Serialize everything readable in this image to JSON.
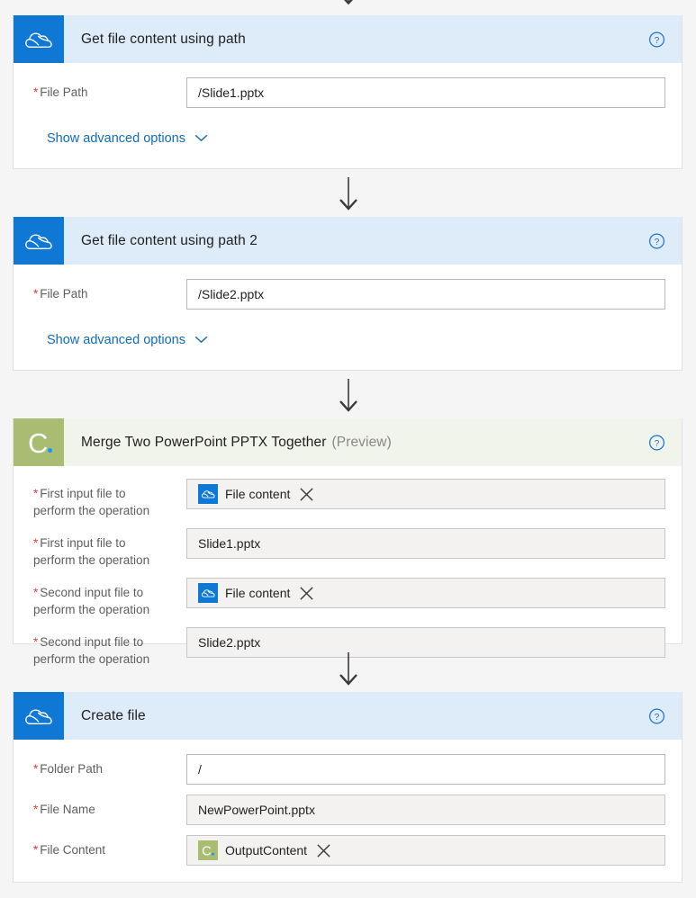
{
  "colors": {
    "page_background": "#f5f5f5",
    "onedrive_blue": "#0f78d4",
    "onedrive_header": "#deecf9",
    "cloudmersive_green": "#a8bc72",
    "cloudmersive_header": "#f1f4ea",
    "link_blue": "#0f6cbd",
    "required_red": "#e03e3e",
    "label_gray": "#605e5c",
    "preview_gray": "#8a8886"
  },
  "cards": [
    {
      "id": "get-file-content-using-path",
      "title": "Get file content using path",
      "preview": "",
      "connector_icon": "chevron-down-arrow-icon",
      "brand_icon": "onedrive-cloud-icon",
      "help_icon": "help-circle-icon",
      "fields": [
        {
          "label": "File Path",
          "required": true,
          "type": "text",
          "value": "/Slide1.pptx",
          "placeholder": "",
          "style": "white"
        }
      ],
      "advanced_link": {
        "label": "Show advanced options",
        "icon": "chevron-down-icon"
      }
    },
    {
      "id": "get-file-content-using-path-2",
      "title": "Get file content using path 2",
      "preview": "",
      "connector_icon": "chevron-down-arrow-icon",
      "brand_icon": "onedrive-cloud-icon",
      "help_icon": "help-circle-icon",
      "fields": [
        {
          "label": "File Path",
          "required": true,
          "type": "text",
          "value": "/Slide2.pptx",
          "placeholder": "",
          "style": "white"
        }
      ],
      "advanced_link": {
        "label": "Show advanced options",
        "icon": "chevron-down-icon"
      }
    },
    {
      "id": "merge-two-powerpoint-pptx-together",
      "title": "Merge Two PowerPoint PPTX Together",
      "preview": "(Preview)",
      "connector_icon": "chevron-down-arrow-icon",
      "brand_icon": "cloudmersive-c-icon",
      "help_icon": "help-circle-icon",
      "fields": [
        {
          "label": "First input file to\nperform the operation",
          "required": true,
          "type": "token",
          "token_label": "File content",
          "token_icon": "onedrive-cloud-icon",
          "remove_icon": "close-x-icon",
          "style": "filled"
        },
        {
          "label": "First input file to\nperform the operation",
          "required": true,
          "type": "text",
          "value": "Slide1.pptx",
          "placeholder": "",
          "style": "filled"
        },
        {
          "label": "Second input file to\nperform the operation",
          "required": true,
          "type": "token",
          "token_label": "File content",
          "token_icon": "onedrive-cloud-icon",
          "remove_icon": "close-x-icon",
          "style": "filled"
        },
        {
          "label": "Second input file to\nperform the operation",
          "required": true,
          "type": "text",
          "value": "Slide2.pptx",
          "placeholder": "",
          "style": "filled"
        }
      ],
      "advanced_link": null
    },
    {
      "id": "create-file",
      "title": "Create file",
      "preview": "",
      "connector_icon": "chevron-down-arrow-icon",
      "brand_icon": "onedrive-cloud-icon",
      "help_icon": "help-circle-icon",
      "fields": [
        {
          "label": "Folder Path",
          "required": true,
          "type": "text",
          "value": "/",
          "placeholder": "",
          "style": "white"
        },
        {
          "label": "File Name",
          "required": true,
          "type": "text",
          "value": "NewPowerPoint.pptx",
          "placeholder": "",
          "style": "filled"
        },
        {
          "label": "File Content",
          "required": true,
          "type": "token",
          "token_label": "OutputContent",
          "token_icon": "cloudmersive-c-icon",
          "remove_icon": "close-x-icon",
          "style": "filled"
        }
      ],
      "advanced_link": null
    }
  ]
}
